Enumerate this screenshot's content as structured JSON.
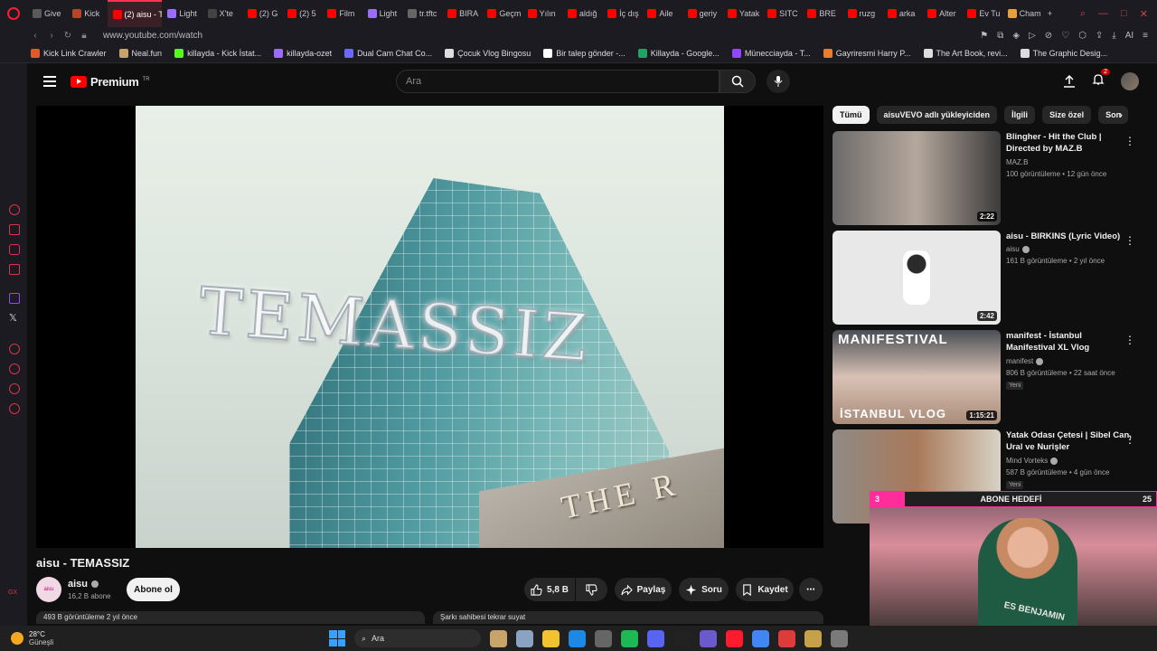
{
  "browser": {
    "tabs": [
      {
        "label": "Give",
        "color": "#5a5a5a"
      },
      {
        "label": "Kick",
        "color": "#b5442a"
      },
      {
        "label": "(2) aisu - T",
        "color": "#ff0000",
        "active": true
      },
      {
        "label": "Light",
        "color": "#9a6cff"
      },
      {
        "label": "X'te",
        "color": "#444444"
      },
      {
        "label": "(2) G",
        "color": "#ff0000"
      },
      {
        "label": "(2) 5",
        "color": "#ff0000"
      },
      {
        "label": "Film",
        "color": "#ff0000"
      },
      {
        "label": "Light",
        "color": "#9a6cff"
      },
      {
        "label": "tr.tftc",
        "color": "#666666"
      },
      {
        "label": "BIRA",
        "color": "#ff0000"
      },
      {
        "label": "Geçm",
        "color": "#ff0000"
      },
      {
        "label": "Yılın",
        "color": "#ff0000"
      },
      {
        "label": "aldığ",
        "color": "#ff0000"
      },
      {
        "label": "İç dış",
        "color": "#ff0000"
      },
      {
        "label": "Aile",
        "color": "#ff0000"
      },
      {
        "label": "geriy",
        "color": "#ff0000"
      },
      {
        "label": "Yatak",
        "color": "#ff0000"
      },
      {
        "label": "SITC",
        "color": "#ff0000"
      },
      {
        "label": "BRE",
        "color": "#ff0000"
      },
      {
        "label": "ruzg",
        "color": "#ff0000"
      },
      {
        "label": "arka",
        "color": "#ff0000"
      },
      {
        "label": "Alter",
        "color": "#ff0000"
      },
      {
        "label": "Ev Tu",
        "color": "#ff0000"
      },
      {
        "label": "Cham",
        "color": "#e8a13a"
      }
    ],
    "new_tab": "+",
    "url": "www.youtube.com/watch",
    "ai_label": "AI",
    "bookmarks": [
      {
        "label": "Kick Link Crawler",
        "color": "#e0592a"
      },
      {
        "label": "Neal.fun",
        "color": "#c8a36a"
      },
      {
        "label": "killayda - Kick İstat...",
        "color": "#53fc18"
      },
      {
        "label": "killayda-ozet",
        "color": "#9c6cff"
      },
      {
        "label": "Dual Cam Chat Co...",
        "color": "#6a6aff"
      },
      {
        "label": "Çocuk Vlog Bingosu",
        "color": "#dddddd"
      },
      {
        "label": "Bir talep gönder -...",
        "color": "#ffffff"
      },
      {
        "label": "Killayda - Google...",
        "color": "#1fa463"
      },
      {
        "label": "Münecciayda - T...",
        "color": "#9146ff"
      },
      {
        "label": "Gayriresmi Harry P...",
        "color": "#e87d2c"
      },
      {
        "label": "The Art Book, revi...",
        "color": "#dddddd"
      },
      {
        "label": "The Graphic Desig...",
        "color": "#dddddd"
      }
    ]
  },
  "youtube": {
    "logo_text": "Premium",
    "logo_sup": "TR",
    "search_placeholder": "Ara",
    "notifications": "2",
    "video": {
      "title": "aisu - TEMASSIZ",
      "overlay_title": "TEMASSIZ",
      "building_sign": "THE R",
      "channel": "aisu",
      "channel_avatar_text": "aisu",
      "subscribers": "16,2 B abone",
      "subscribe": "Abone ol",
      "likes": "5,8 B",
      "share": "Paylaş",
      "ask": "Soru",
      "save": "Kaydet",
      "views_peek": "493 B görüntüleme  2 yıl önce",
      "comment_peek": "Şarkı sahibesi tekrar suyat"
    },
    "chips": [
      "Tümü",
      "aisuVEVO adlı yükleyiciden",
      "İlgili",
      "Size özel",
      "Son"
    ],
    "recommendations": [
      {
        "title": "Blingher - Hit the Club | Directed by MAZ.B",
        "channel": "MAZ.B",
        "meta": "100 görüntüleme • 12 gün önce",
        "duration": "2:22",
        "verified": false,
        "new": ""
      },
      {
        "title": "aisu - BIRKINS (Lyric Video)",
        "channel": "aisu",
        "meta": "161 B görüntüleme • 2 yıl önce",
        "duration": "2:42",
        "verified": true,
        "new": ""
      },
      {
        "title": "manifest - İstanbul Manifestival XL Vlog",
        "channel": "manifest",
        "meta": "806 B görüntüleme • 22 saat önce",
        "duration": "1:15:21",
        "verified": true,
        "new": "Yeni",
        "thumb_top": "MANIFESTIVAL",
        "thumb_bottom": "İSTANBUL VLOG"
      },
      {
        "title": "Yatak Odası Çetesi | Sibel Can, Ural ve Nurişler",
        "channel": "Mind Vorteks",
        "meta": "587 B görüntüleme • 4 gün önce",
        "duration": "",
        "verified": true,
        "new": "Yeni"
      }
    ]
  },
  "stream_overlay": {
    "goal_label": "ABONE HEDEFİ",
    "goal_current": "3",
    "goal_target": "25",
    "goal_progress": 0.12,
    "shirt_text": "ES BENJAMIN"
  },
  "taskbar": {
    "temperature": "28°C",
    "weather": "Güneşli",
    "search": "Ara",
    "apps": [
      "#c9a46a",
      "#8aa3c2",
      "#f2c230",
      "#1e88e5",
      "#666666",
      "#1db954",
      "#5865f2",
      "#222222",
      "#6a5acd",
      "#ff1b2d",
      "#4285f4",
      "#e03b3b",
      "#c7a14a",
      "#7a7a7a"
    ]
  }
}
